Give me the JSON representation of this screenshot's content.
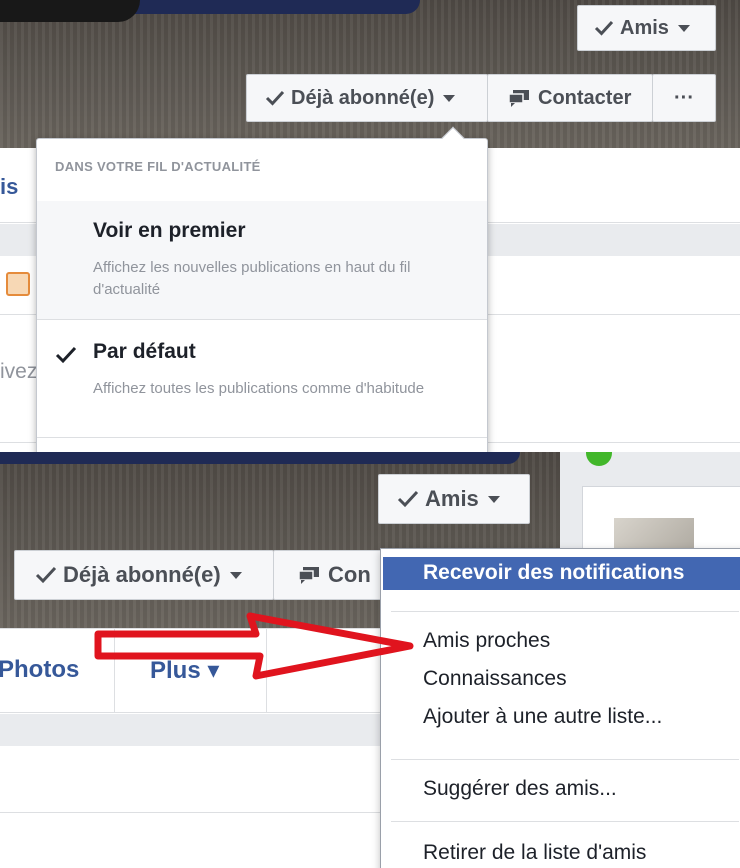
{
  "top": {
    "amis_button": "Amis",
    "subscribed_button": "Déjà abonné(e)",
    "contact_button": "Contacter",
    "more_button": "···",
    "left_fragments": {
      "name_fragment": "is",
      "text_fragment": "ivez"
    },
    "dropdown": {
      "header": "DANS VOTRE FIL D'ACTUALITÉ",
      "options": [
        {
          "title": "Voir en premier",
          "description": "Affichez les nouvelles publications en haut du fil d'actualité",
          "checked": false
        },
        {
          "title": "Par défaut",
          "description": "Affichez toutes les publications comme d'habitude",
          "checked": true
        }
      ]
    }
  },
  "bottom": {
    "amis_button": "Amis",
    "subscribed_button": "Déjà abonné(e)",
    "contact_button_partial": "Con",
    "tabs": {
      "photos": "Photos",
      "plus": "Plus ▾"
    },
    "menu": {
      "highlighted": "Recevoir des notifications",
      "items": [
        "Amis proches",
        "Connaissances",
        "Ajouter à une autre liste..."
      ],
      "suggest": "Suggérer des amis...",
      "remove": "Retirer de la liste d'amis"
    }
  },
  "colors": {
    "facebook_blue": "#4267b2",
    "link_blue": "#365899",
    "annotation_red": "#e0141e",
    "online_green": "#42b72a"
  }
}
